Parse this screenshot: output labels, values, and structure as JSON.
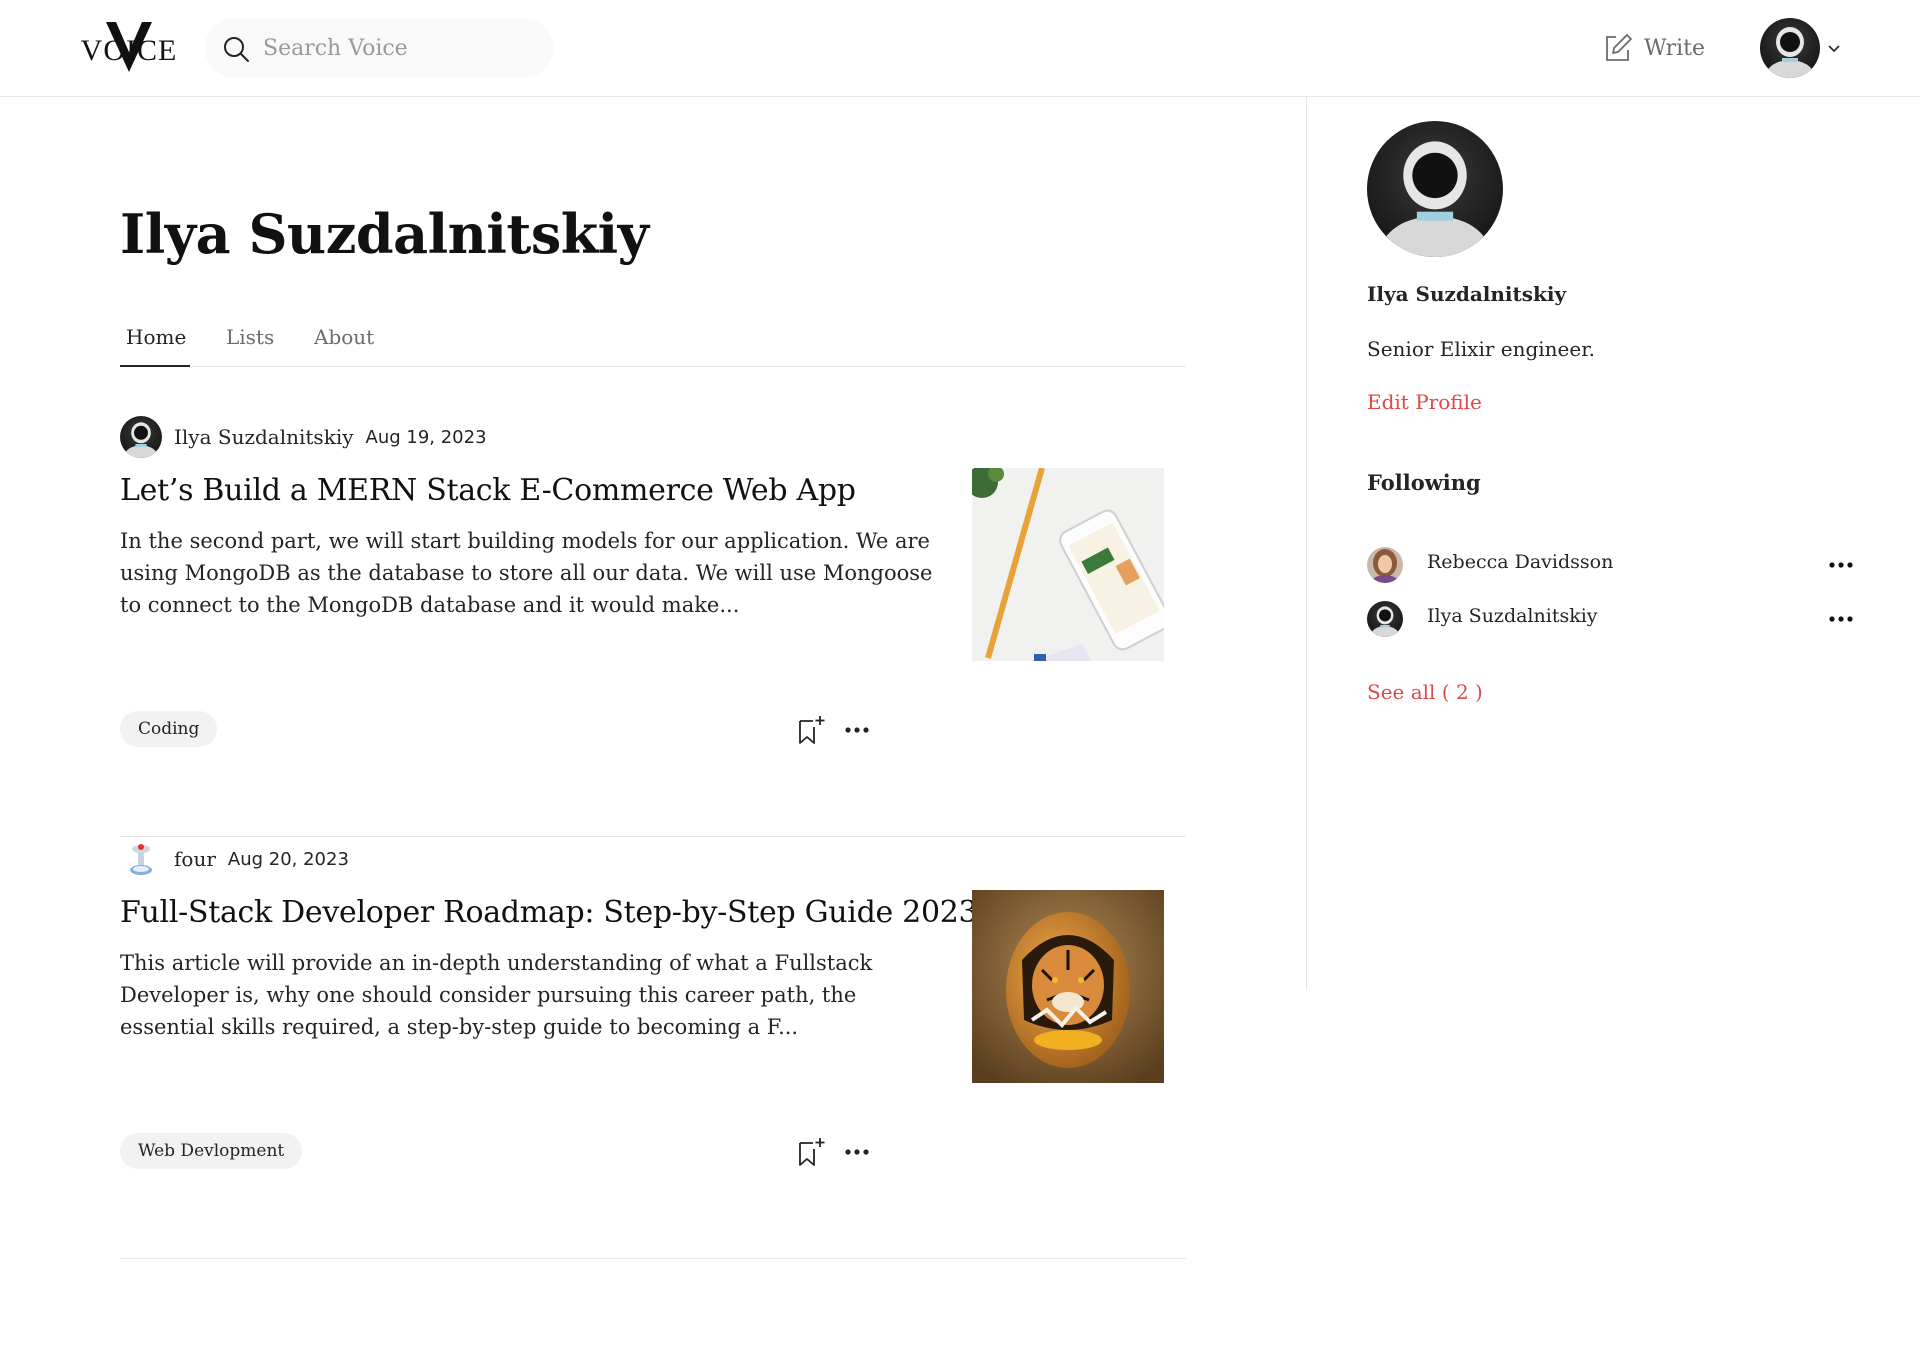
{
  "header": {
    "logo_text": "VOICE",
    "search_placeholder": "Search Voice",
    "write_label": "Write"
  },
  "profile": {
    "name": "Ilya Suzdalnitskiy",
    "tabs": [
      {
        "label": "Home",
        "active": true
      },
      {
        "label": "Lists",
        "active": false
      },
      {
        "label": "About",
        "active": false
      }
    ]
  },
  "articles": [
    {
      "author": "Ilya Suzdalnitskiy",
      "date": "Aug 19, 2023",
      "title": "Let’s Build a MERN Stack E-Commerce Web App",
      "excerpt": "In the second part, we will start building models for our application. We are using MongoDB as the database to store all our data. We will use Mongoose to connect to the MongoDB database and it would make...",
      "tag": "Coding",
      "thumbnail_icon": "phone-on-desk-image"
    },
    {
      "author": "four",
      "date": "Aug 20, 2023",
      "title": "Full-Stack Developer Roadmap: Step-by-Step Guide 2023",
      "excerpt": "This article will provide an in-depth understanding of what a Fullstack Developer is, why one should consider pursuing this career path, the essential skills required, a step-by-step guide to becoming a F...",
      "tag": "Web Devlopment",
      "thumbnail_icon": "tiger-in-egg-image"
    }
  ],
  "sidebar": {
    "name": "Ilya Suzdalnitskiy",
    "bio": "Senior Elixir engineer.",
    "edit_label": "Edit Profile",
    "following_label": "Following",
    "following": [
      {
        "name": "Rebecca Davidsson",
        "avatar_icon": "woman-portrait-avatar"
      },
      {
        "name": "Ilya Suzdalnitskiy",
        "avatar_icon": "robot-avatar"
      }
    ],
    "see_all_label": "See all ( 2 )"
  },
  "colors": {
    "accent_red": "#e04848",
    "text": "#242424",
    "muted": "#6b6b6b",
    "divider": "#e6e6e6",
    "tag_bg": "#f2f2f2"
  }
}
